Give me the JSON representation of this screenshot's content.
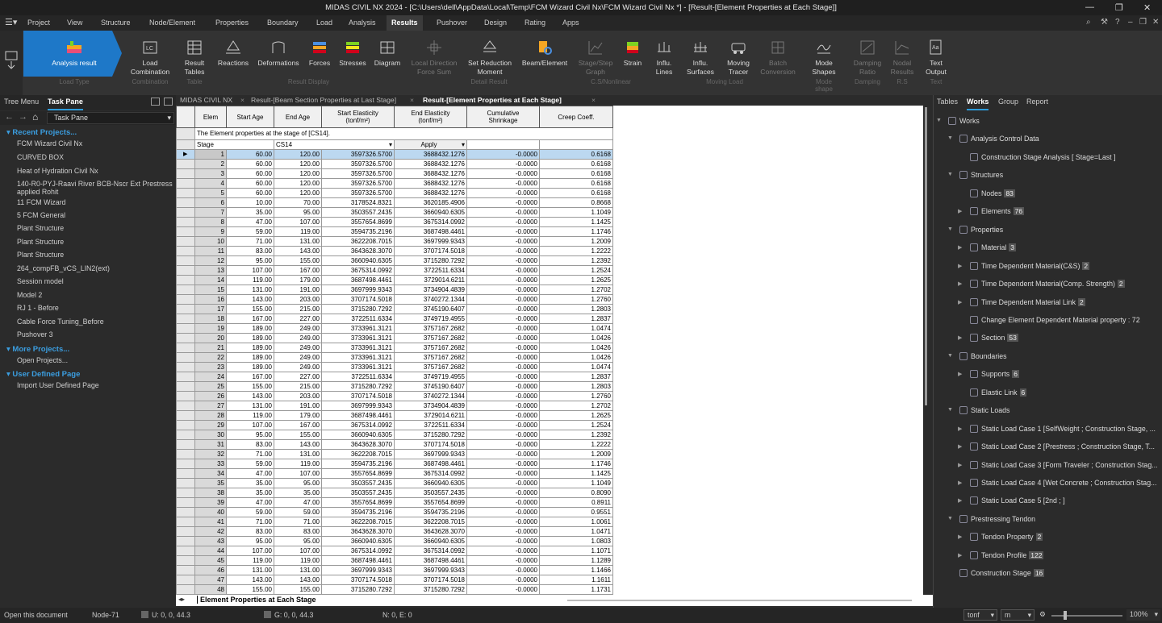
{
  "titlebar": {
    "title": "MIDAS CIVIL NX 2024 - [C:\\Users\\dell\\AppData\\Local\\Temp\\FCM Wizard Civil Nx\\FCM Wizard Civil Nx *] - [Result-[Element Properties at Each Stage]]"
  },
  "menu": [
    "Project",
    "View",
    "Structure",
    "Node/Element",
    "Properties",
    "Boundary",
    "Load",
    "Analysis",
    "Results",
    "Pushover",
    "Design",
    "Rating",
    "Apps"
  ],
  "ribbon": {
    "buttons": [
      {
        "label": "Analysis result",
        "icon": "analysis-result-icon"
      },
      {
        "label": "Load\nCombination",
        "icon": "load-combination-icon"
      },
      {
        "label": "Result\nTables",
        "icon": "result-tables-icon"
      },
      {
        "label": "Reactions",
        "icon": "reactions-icon"
      },
      {
        "label": "Deformations",
        "icon": "deformations-icon"
      },
      {
        "label": "Forces",
        "icon": "forces-icon"
      },
      {
        "label": "Stresses",
        "icon": "stresses-icon"
      },
      {
        "label": "Diagram",
        "icon": "diagram-icon"
      },
      {
        "label": "Local Direction\nForce Sum",
        "icon": "local-direction-icon"
      },
      {
        "label": "Set Reduction\nMoment",
        "icon": "reduction-moment-icon"
      },
      {
        "label": "Beam/Element",
        "icon": "beam-element-icon"
      },
      {
        "label": "Stage/Step\nGraph",
        "icon": "stage-graph-icon"
      },
      {
        "label": "Strain",
        "icon": "strain-icon"
      },
      {
        "label": "Influ.\nLines",
        "icon": "influence-lines-icon"
      },
      {
        "label": "Influ.\nSurfaces",
        "icon": "influence-surfaces-icon"
      },
      {
        "label": "Moving\nTracer",
        "icon": "moving-tracer-icon"
      },
      {
        "label": "Batch\nConversion",
        "icon": "batch-conversion-icon"
      },
      {
        "label": "Mode\nShapes",
        "icon": "mode-shapes-icon"
      },
      {
        "label": "Damping\nRatio",
        "icon": "damping-ratio-icon"
      },
      {
        "label": "Nodal\nResults",
        "icon": "nodal-results-icon"
      },
      {
        "label": "Text\nOutput",
        "icon": "text-output-icon"
      }
    ],
    "groups": [
      "Load Type",
      "Combination",
      "Table",
      "Result Display",
      "Detail Result",
      "C.S/Nonlinear",
      "Moving Load",
      "Mode shape",
      "Damping",
      "R.S",
      "Text"
    ]
  },
  "leftpane": {
    "tabs": [
      "Tree Menu",
      "Task Pane"
    ],
    "combo": "Task Pane",
    "recent_header": "Recent Projects...",
    "recent": [
      "FCM Wizard Civil Nx",
      "CURVED BOX",
      "Heat of Hydration Civil Nx",
      "140-R0-PYJ-Raavi River BCB-Nscr Ext Prestress applied Rohit",
      "11 FCM Wizard",
      "5 FCM General",
      "Plant Structure",
      "Plant Structure",
      "Plant Structure",
      "264_compFB_vCS_LIN2(ext)",
      "Session model",
      "Model 2",
      "RJ 1 - Before",
      "Cable Force Tuning_Before",
      "Pushover 3"
    ],
    "more_header": "More Projects...",
    "more": [
      "Open Projects..."
    ],
    "user_header": "User Defined Page",
    "user": [
      "Import User Defined Page"
    ]
  },
  "doctabs": [
    "MIDAS CIVIL NX",
    "Result-[Beam Section Properties at Last Stage]",
    "Result-[Element Properties at Each Stage]"
  ],
  "table": {
    "headers": [
      "Elem",
      "Start Age",
      "End Age",
      "Start Elasticity\n(tonf/m²)",
      "End Elasticity\n(tonf/m²)",
      "Cumulative\nShrinkage",
      "Creep Coeff."
    ],
    "caption": "The Element properties at the stage of [CS14].",
    "stage_label": "Stage",
    "stage_value": "CS14",
    "apply": "Apply",
    "rows": [
      [
        "1",
        "60.00",
        "120.00",
        "3597326.5700",
        "3688432.1276",
        "-0.0000",
        "0.6168"
      ],
      [
        "2",
        "60.00",
        "120.00",
        "3597326.5700",
        "3688432.1276",
        "-0.0000",
        "0.6168"
      ],
      [
        "3",
        "60.00",
        "120.00",
        "3597326.5700",
        "3688432.1276",
        "-0.0000",
        "0.6168"
      ],
      [
        "4",
        "60.00",
        "120.00",
        "3597326.5700",
        "3688432.1276",
        "-0.0000",
        "0.6168"
      ],
      [
        "5",
        "60.00",
        "120.00",
        "3597326.5700",
        "3688432.1276",
        "-0.0000",
        "0.6168"
      ],
      [
        "6",
        "10.00",
        "70.00",
        "3178524.8321",
        "3620185.4906",
        "-0.0000",
        "0.8668"
      ],
      [
        "7",
        "35.00",
        "95.00",
        "3503557.2435",
        "3660940.6305",
        "-0.0000",
        "1.1049"
      ],
      [
        "8",
        "47.00",
        "107.00",
        "3557654.8699",
        "3675314.0992",
        "-0.0000",
        "1.1425"
      ],
      [
        "9",
        "59.00",
        "119.00",
        "3594735.2196",
        "3687498.4461",
        "-0.0000",
        "1.1746"
      ],
      [
        "10",
        "71.00",
        "131.00",
        "3622208.7015",
        "3697999.9343",
        "-0.0000",
        "1.2009"
      ],
      [
        "11",
        "83.00",
        "143.00",
        "3643628.3070",
        "3707174.5018",
        "-0.0000",
        "1.2222"
      ],
      [
        "12",
        "95.00",
        "155.00",
        "3660940.6305",
        "3715280.7292",
        "-0.0000",
        "1.2392"
      ],
      [
        "13",
        "107.00",
        "167.00",
        "3675314.0992",
        "3722511.6334",
        "-0.0000",
        "1.2524"
      ],
      [
        "14",
        "119.00",
        "179.00",
        "3687498.4461",
        "3729014.6211",
        "-0.0000",
        "1.2625"
      ],
      [
        "15",
        "131.00",
        "191.00",
        "3697999.9343",
        "3734904.4839",
        "-0.0000",
        "1.2702"
      ],
      [
        "16",
        "143.00",
        "203.00",
        "3707174.5018",
        "3740272.1344",
        "-0.0000",
        "1.2760"
      ],
      [
        "17",
        "155.00",
        "215.00",
        "3715280.7292",
        "3745190.6407",
        "-0.0000",
        "1.2803"
      ],
      [
        "18",
        "167.00",
        "227.00",
        "3722511.6334",
        "3749719.4955",
        "-0.0000",
        "1.2837"
      ],
      [
        "19",
        "189.00",
        "249.00",
        "3733961.3121",
        "3757167.2682",
        "-0.0000",
        "1.0474"
      ],
      [
        "20",
        "189.00",
        "249.00",
        "3733961.3121",
        "3757167.2682",
        "-0.0000",
        "1.0426"
      ],
      [
        "21",
        "189.00",
        "249.00",
        "3733961.3121",
        "3757167.2682",
        "-0.0000",
        "1.0426"
      ],
      [
        "22",
        "189.00",
        "249.00",
        "3733961.3121",
        "3757167.2682",
        "-0.0000",
        "1.0426"
      ],
      [
        "23",
        "189.00",
        "249.00",
        "3733961.3121",
        "3757167.2682",
        "-0.0000",
        "1.0474"
      ],
      [
        "24",
        "167.00",
        "227.00",
        "3722511.6334",
        "3749719.4955",
        "-0.0000",
        "1.2837"
      ],
      [
        "25",
        "155.00",
        "215.00",
        "3715280.7292",
        "3745190.6407",
        "-0.0000",
        "1.2803"
      ],
      [
        "26",
        "143.00",
        "203.00",
        "3707174.5018",
        "3740272.1344",
        "-0.0000",
        "1.2760"
      ],
      [
        "27",
        "131.00",
        "191.00",
        "3697999.9343",
        "3734904.4839",
        "-0.0000",
        "1.2702"
      ],
      [
        "28",
        "119.00",
        "179.00",
        "3687498.4461",
        "3729014.6211",
        "-0.0000",
        "1.2625"
      ],
      [
        "29",
        "107.00",
        "167.00",
        "3675314.0992",
        "3722511.6334",
        "-0.0000",
        "1.2524"
      ],
      [
        "30",
        "95.00",
        "155.00",
        "3660940.6305",
        "3715280.7292",
        "-0.0000",
        "1.2392"
      ],
      [
        "31",
        "83.00",
        "143.00",
        "3643628.3070",
        "3707174.5018",
        "-0.0000",
        "1.2222"
      ],
      [
        "32",
        "71.00",
        "131.00",
        "3622208.7015",
        "3697999.9343",
        "-0.0000",
        "1.2009"
      ],
      [
        "33",
        "59.00",
        "119.00",
        "3594735.2196",
        "3687498.4461",
        "-0.0000",
        "1.1746"
      ],
      [
        "34",
        "47.00",
        "107.00",
        "3557654.8699",
        "3675314.0992",
        "-0.0000",
        "1.1425"
      ],
      [
        "35",
        "35.00",
        "95.00",
        "3503557.2435",
        "3660940.6305",
        "-0.0000",
        "1.1049"
      ],
      [
        "38",
        "35.00",
        "35.00",
        "3503557.2435",
        "3503557.2435",
        "-0.0000",
        "0.8090"
      ],
      [
        "39",
        "47.00",
        "47.00",
        "3557654.8699",
        "3557654.8699",
        "-0.0000",
        "0.8911"
      ],
      [
        "40",
        "59.00",
        "59.00",
        "3594735.2196",
        "3594735.2196",
        "-0.0000",
        "0.9551"
      ],
      [
        "41",
        "71.00",
        "71.00",
        "3622208.7015",
        "3622208.7015",
        "-0.0000",
        "1.0061"
      ],
      [
        "42",
        "83.00",
        "83.00",
        "3643628.3070",
        "3643628.3070",
        "-0.0000",
        "1.0471"
      ],
      [
        "43",
        "95.00",
        "95.00",
        "3660940.6305",
        "3660940.6305",
        "-0.0000",
        "1.0803"
      ],
      [
        "44",
        "107.00",
        "107.00",
        "3675314.0992",
        "3675314.0992",
        "-0.0000",
        "1.1071"
      ],
      [
        "45",
        "119.00",
        "119.00",
        "3687498.4461",
        "3687498.4461",
        "-0.0000",
        "1.1289"
      ],
      [
        "46",
        "131.00",
        "131.00",
        "3697999.9343",
        "3697999.9343",
        "-0.0000",
        "1.1466"
      ],
      [
        "47",
        "143.00",
        "143.00",
        "3707174.5018",
        "3707174.5018",
        "-0.0000",
        "1.1611"
      ],
      [
        "48",
        "155.00",
        "155.00",
        "3715280.7292",
        "3715280.7292",
        "-0.0000",
        "1.1731"
      ]
    ]
  },
  "sheet_tab": "Element Properties at Each Stage",
  "rightpane": {
    "tabs": [
      "Tables",
      "Works",
      "Group",
      "Report"
    ],
    "tree": [
      {
        "label": "Works",
        "lvl": 0
      },
      {
        "label": "Analysis Control Data",
        "lvl": 1
      },
      {
        "label": "Construction Stage Analysis [ Stage=Last ]",
        "lvl": 2
      },
      {
        "label": "Structures",
        "lvl": 1
      },
      {
        "label": "Nodes",
        "badge": "83",
        "lvl": 2
      },
      {
        "label": "Elements",
        "badge": "76",
        "lvl": 2
      },
      {
        "label": "Properties",
        "lvl": 1
      },
      {
        "label": "Material",
        "badge": "3",
        "lvl": 2
      },
      {
        "label": "Time Dependent Material(C&S)",
        "badge": "2",
        "lvl": 2
      },
      {
        "label": "Time Dependent Material(Comp. Strength)",
        "badge": "2",
        "lvl": 2
      },
      {
        "label": "Time Dependent Material Link",
        "badge": "2",
        "lvl": 2
      },
      {
        "label": "Change Element Dependent Material property : 72",
        "lvl": 2
      },
      {
        "label": "Section",
        "badge": "53",
        "lvl": 2
      },
      {
        "label": "Boundaries",
        "lvl": 1
      },
      {
        "label": "Supports",
        "badge": "6",
        "lvl": 2
      },
      {
        "label": "Elastic Link",
        "badge": "6",
        "lvl": 2
      },
      {
        "label": "Static Loads",
        "lvl": 1
      },
      {
        "label": "Static Load Case 1 [SelfWeight ; Construction Stage, ...",
        "lvl": 2
      },
      {
        "label": "Static Load Case 2 [Prestress ; Construction Stage, T...",
        "lvl": 2
      },
      {
        "label": "Static Load Case 3 [Form Traveler ; Construction Stag...",
        "lvl": 2
      },
      {
        "label": "Static Load Case 4 [Wet Concrete ; Construction Stag...",
        "lvl": 2
      },
      {
        "label": "Static Load Case 5 [2nd ; ]",
        "lvl": 2
      },
      {
        "label": "Prestressing Tendon",
        "lvl": 1
      },
      {
        "label": "Tendon Property",
        "badge": "2",
        "lvl": 2
      },
      {
        "label": "Tendon Profile",
        "badge": "122",
        "lvl": 2
      },
      {
        "label": "Construction Stage",
        "badge": "16",
        "lvl": 1
      }
    ]
  },
  "status": {
    "left": "Open this document",
    "node": "Node-71",
    "u": "U: 0, 0, 44.3",
    "g": "G: 0, 0, 44.3",
    "ne": "N: 0, E: 0",
    "force_unit": "tonf",
    "length_unit": "m",
    "zoom": "100%"
  }
}
